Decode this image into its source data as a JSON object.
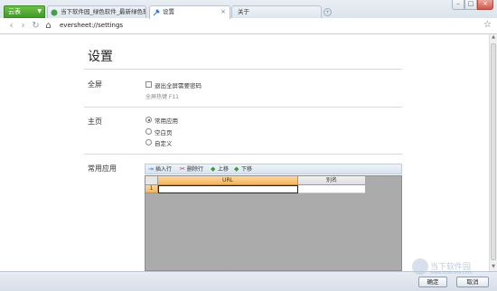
{
  "browser": {
    "brand_label": "云表",
    "tabs": [
      {
        "label": "当下软件园_绿色软件_最新绿色软件下载"
      },
      {
        "label": "设置"
      },
      {
        "label": "关于"
      }
    ],
    "url": "eversheet://settings"
  },
  "page": {
    "title": "设置",
    "fullscreen": {
      "section_label": "全屏",
      "checkbox_label": "退出全屏需要密码",
      "checked": false,
      "hint": "全屏热键 F11"
    },
    "homepage": {
      "section_label": "主页",
      "options": [
        {
          "label": "常用应用",
          "selected": true
        },
        {
          "label": "空白页",
          "selected": false
        },
        {
          "label": "自定义",
          "selected": false
        }
      ]
    },
    "apps": {
      "section_label": "常用应用",
      "toolbar": {
        "insert_row": "插入行",
        "delete_row": "删除行",
        "move_up": "上移",
        "move_down": "下移"
      },
      "columns": [
        "URL",
        "别名"
      ],
      "rows": [
        {
          "num": "1",
          "url": "",
          "alias": ""
        }
      ]
    }
  },
  "footer": {
    "ok_label": "确定",
    "cancel_label": "取消"
  },
  "watermark": {
    "text": "当下软件园",
    "sub": "www.downxia.com"
  },
  "colors": {
    "brand_green": "#4aa52f",
    "header_orange": "#f5b45a"
  }
}
